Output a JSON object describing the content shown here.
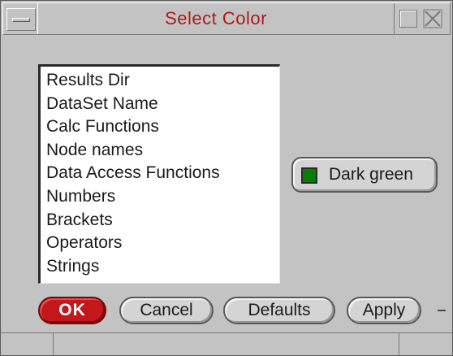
{
  "window": {
    "title": "Select Color"
  },
  "list": {
    "items": [
      "Results Dir",
      "DataSet Name",
      "Calc Functions",
      "Node names",
      "Data Access Functions",
      "Numbers",
      "Brackets",
      "Operators",
      "Strings"
    ]
  },
  "color_button": {
    "label": "Dark green",
    "swatch_color": "#0a7a0a"
  },
  "buttons": {
    "ok": "OK",
    "cancel": "Cancel",
    "defaults": "Defaults",
    "apply": "Apply"
  },
  "colors": {
    "title_text": "#b01818",
    "ok_bg": "#c4161b",
    "window_bg": "#c3c3c3"
  }
}
